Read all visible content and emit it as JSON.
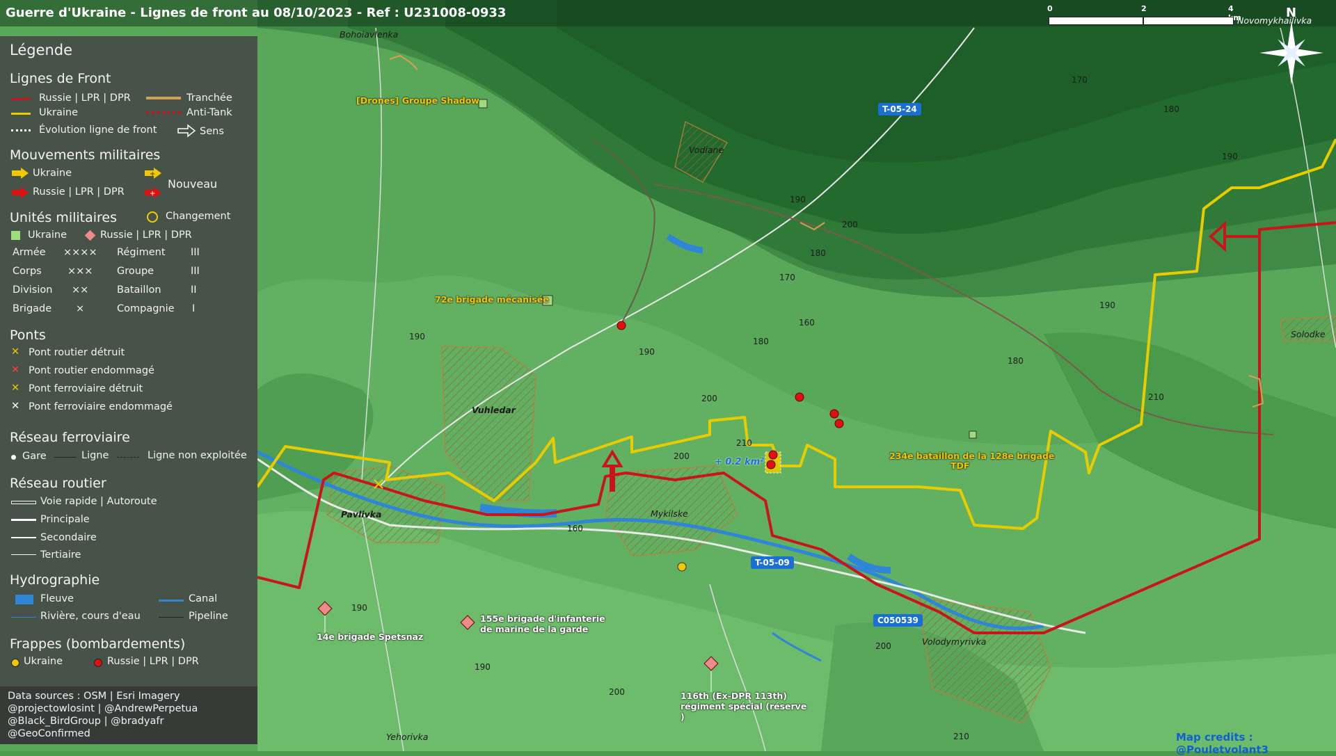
{
  "title": "Guerre d'Ukraine - Lignes de front au 08/10/2023 - Ref : U231008-0933",
  "scale": {
    "labels": [
      "0",
      "2",
      "4 km"
    ]
  },
  "north_label": "N",
  "colors": {
    "russia_line": "#c8151b",
    "ukraine_line": "#f0d000",
    "map_green": "#4e9a4e",
    "water": "#2f86d6"
  },
  "legend": {
    "title": "Légende",
    "front_lines": {
      "heading": "Lignes de Front",
      "russia": "Russie | LPR | DPR",
      "trench": "Tranchée",
      "ukraine": "Ukraine",
      "antitank": "Anti-Tank",
      "evolution": "Évolution ligne de front",
      "direction": "Sens"
    },
    "movements": {
      "heading": "Mouvements militaires",
      "ukraine": "Ukraine",
      "new": "Nouveau",
      "russia": "Russie | LPR | DPR"
    },
    "units": {
      "heading": "Unités militaires",
      "change": "Changement",
      "ukraine": "Ukraine",
      "russia": "Russie | LPR | DPR",
      "rows": [
        {
          "name": "Armée",
          "sym": "×××× ",
          "name2": "Régiment",
          "sym2": "III"
        },
        {
          "name": "Corps",
          "sym": "×××",
          "name2": "Groupe",
          "sym2": "III"
        },
        {
          "name": "Division",
          "sym": "××",
          "name2": "Bataillon",
          "sym2": "II"
        },
        {
          "name": "Brigade",
          "sym": "×",
          "name2": "Compagnie",
          "sym2": "I"
        }
      ]
    },
    "bridges": {
      "heading": "Ponts",
      "items": [
        "Pont routier détruit",
        "Pont routier endommagé",
        "Pont ferroviaire détruit",
        "Pont ferroviaire endommagé"
      ]
    },
    "rail": {
      "heading": "Réseau ferroviaire",
      "station": "Gare",
      "line": "Ligne",
      "unused": "Ligne non exploitée"
    },
    "roads": {
      "heading": "Réseau routier",
      "items": [
        "Voie rapide | Autoroute",
        "Principale",
        "Secondaire",
        "Tertiaire"
      ]
    },
    "hydro": {
      "heading": "Hydrographie",
      "river_big": "Fleuve",
      "canal": "Canal",
      "river": "Rivière, cours d'eau",
      "pipeline": "Pipeline"
    },
    "strikes": {
      "heading": "Frappes (bombardements)",
      "ukraine": "Ukraine",
      "russia": "Russie | LPR | DPR"
    },
    "sources": [
      "Data sources : OSM | Esri Imagery",
      "@projectowlosint | @AndrewPerpetua",
      "@Black_BirdGroup | @bradyafr",
      "@GeoConfirmed"
    ]
  },
  "map": {
    "towns": {
      "bohoiavlenka": "Bohoiavlenka",
      "novomykhailivka": "Novomykhailivka",
      "vodiane": "Vodiane",
      "vuhledar": "Vuhledar",
      "pavlivka": "Pavlivka",
      "mykilske": "Mykilske",
      "volodymyrivka": "Volodymyrivka",
      "solodke": "Solodke",
      "yehorivka": "Yehorivka"
    },
    "roads": [
      "T-05-24",
      "T-05-09",
      "C050539"
    ],
    "units": {
      "drones": "[Drones] Groupe Shadow",
      "brig72": "72e brigade mécanisée",
      "bat234a": "234e bataillon de la 128e brigade",
      "bat234b": "TDF",
      "brig14": "14e brigade Spetsnaz",
      "brig155a": "155e brigade d'infanterie",
      "brig155b": "de marine de la garde",
      "reg116a": "116th (Ex-DPR 113th)",
      "reg116b": "régiment spécial (réserve",
      "reg116c": ")"
    },
    "gain": "+ 0.2 km²",
    "elevations": {
      "e1": "170",
      "e2": "180",
      "e3": "190",
      "e4": "190",
      "e5": "200",
      "e6": "180",
      "e7": "170",
      "e8": "160",
      "e9": "180",
      "e10": "190",
      "e11": "190",
      "e12": "200",
      "e13": "210",
      "e14": "200",
      "e15": "180",
      "e16": "190",
      "e17": "210",
      "e18": "160",
      "e19": "190",
      "e20": "190",
      "e21": "200",
      "e22": "200",
      "e23": "210"
    }
  },
  "credit": "Map credits : @Pouletvolant3"
}
